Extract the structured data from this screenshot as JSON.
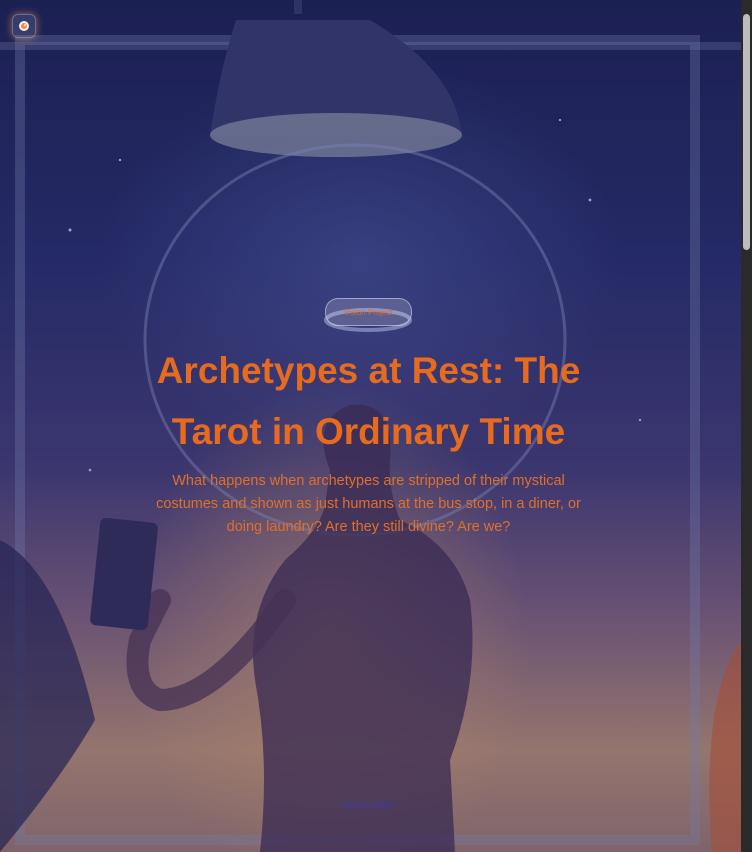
{
  "header": {
    "logo_icon": "orange-glow-circle-icon"
  },
  "hero": {
    "badge_label": "Vision Project",
    "title": "Archetypes at Rest: The Tarot in Ordinary Time",
    "subtitle": "What happens when archetypes are stripped of their mystical costumes and shown as just humans at the bus stop, in a diner, or doing laundry? Are they still divine? Are we?",
    "scroll_hint": "Scroll to explore"
  },
  "colors": {
    "accent": "#e66b1e",
    "background_top": "#1e2458",
    "background_bottom": "#c69a7e"
  }
}
